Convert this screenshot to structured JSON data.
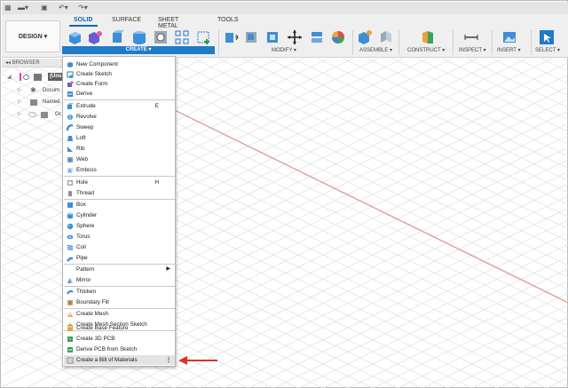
{
  "colors": {
    "accent": "#0f67b1",
    "create_bar": "#1f7ac7",
    "axis_red": "#e37b7b",
    "callout": "#d9342b"
  },
  "toolbar": {
    "design_label": "DESIGN ▾",
    "tabs": [
      {
        "label": "SOLID",
        "active": true
      },
      {
        "label": "SURFACE",
        "active": false
      },
      {
        "label": "SHEET METAL",
        "active": false
      },
      {
        "label": "TOOLS",
        "active": false
      }
    ],
    "groups": {
      "create": "CREATE ▾",
      "modify": "MODIFY ▾",
      "assemble": "ASSEMBLE ▾",
      "construct": "CONSTRUCT ▾",
      "inspect": "INSPECT ▾",
      "insert": "INSERT ▾",
      "select": "SELECT ▾"
    }
  },
  "browser": {
    "title": "BROWSER",
    "items": [
      {
        "label": "(Uns"
      },
      {
        "label": "Docum"
      },
      {
        "label": "Named"
      },
      {
        "label": "Or"
      }
    ]
  },
  "menu": {
    "items": [
      {
        "label": "New Component",
        "icon": "new-component-icon"
      },
      {
        "label": "Create Sketch",
        "icon": "sketch-icon"
      },
      {
        "label": "Create Form",
        "icon": "form-icon"
      },
      {
        "label": "Derive",
        "icon": "derive-icon"
      },
      {
        "label": "Extrude",
        "icon": "extrude-icon",
        "shortcut": "E"
      },
      {
        "label": "Revolve",
        "icon": "revolve-icon"
      },
      {
        "label": "Sweep",
        "icon": "sweep-icon"
      },
      {
        "label": "Loft",
        "icon": "loft-icon"
      },
      {
        "label": "Rib",
        "icon": "rib-icon"
      },
      {
        "label": "Web",
        "icon": "web-icon"
      },
      {
        "label": "Emboss",
        "icon": "emboss-icon"
      },
      {
        "label": "Hole",
        "icon": "hole-icon",
        "shortcut": "H"
      },
      {
        "label": "Thread",
        "icon": "thread-icon"
      },
      {
        "label": "Box",
        "icon": "box-icon"
      },
      {
        "label": "Cylinder",
        "icon": "cylinder-icon"
      },
      {
        "label": "Sphere",
        "icon": "sphere-icon"
      },
      {
        "label": "Torus",
        "icon": "torus-icon"
      },
      {
        "label": "Coil",
        "icon": "coil-icon"
      },
      {
        "label": "Pipe",
        "icon": "pipe-icon"
      },
      {
        "label": "Pattern",
        "icon": "",
        "submenu": "▶"
      },
      {
        "label": "Mirror",
        "icon": "mirror-icon"
      },
      {
        "label": "Thicken",
        "icon": "thicken-icon"
      },
      {
        "label": "Boundary Fill",
        "icon": "boundary-fill-icon"
      },
      {
        "label": "Create Mesh",
        "icon": "mesh-icon"
      },
      {
        "label": "Create Mesh Section Sketch",
        "icon": "mesh-section-icon"
      },
      {
        "label": "Create Base Feature",
        "icon": "base-feature-icon"
      },
      {
        "label": "Create 3D PCB",
        "icon": "pcb-icon"
      },
      {
        "label": "Derive PCB from Sketch",
        "icon": "derive-pcb-icon"
      },
      {
        "label": "Create a Bill of Materials",
        "icon": "bom-icon",
        "more": "⋮"
      }
    ]
  }
}
